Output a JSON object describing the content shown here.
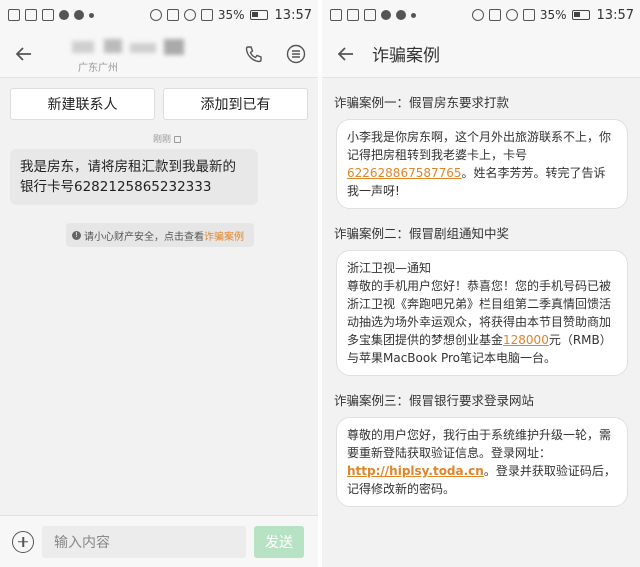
{
  "status_bar": {
    "battery_pct": "35%",
    "time": "13:57"
  },
  "left_screen": {
    "contact_subtitle": "广东广州",
    "new_contact_label": "新建联系人",
    "add_existing_label": "添加到已有",
    "delivered_label": "刚刚",
    "message_text": "我是房东，请将房租汇款到我最新的银行卡号6282125865232333",
    "warning_prefix": "请小心财产安全，点击查看",
    "warning_link": "诈骗案例",
    "input_placeholder": "输入内容",
    "send_label": "发送"
  },
  "right_screen": {
    "title": "诈骗案例",
    "cases": [
      {
        "title": "诈骗案例一：假冒房东要求打款",
        "text_before": "小李我是你房东啊，这个月外出旅游联系不上，你记得把房租转到我老婆卡上，卡号",
        "highlight": "6226288675877​65",
        "text_after": "。姓名李芳芳。转完了告诉我一声呀!"
      },
      {
        "title": "诈骗案例二：假冒剧组通知中奖",
        "line1": "浙江卫视—通知",
        "text_before": "尊敬的手机用户您好！恭喜您！您的手机号码已被浙江卫视《奔跑吧兄弟》栏目组第二季真情回馈活动抽选为场外幸运观众，将获得由本节目赞助商加多宝集团提供的梦想创业基金",
        "highlight": "128000",
        "text_after": "元（RMB）与苹果MacBook Pro笔记本电脑一台。"
      },
      {
        "title": "诈骗案例三：假冒银行要求登录网站",
        "text_before": "尊敬的用户您好，我行由于系统维护升级一轮，需要重新登陆获取验证信息。登录网址：",
        "highlight": "http://hiplsy.toda.cn",
        "text_after": "。登录并获取验证码后，记得修改新的密码。"
      }
    ]
  }
}
